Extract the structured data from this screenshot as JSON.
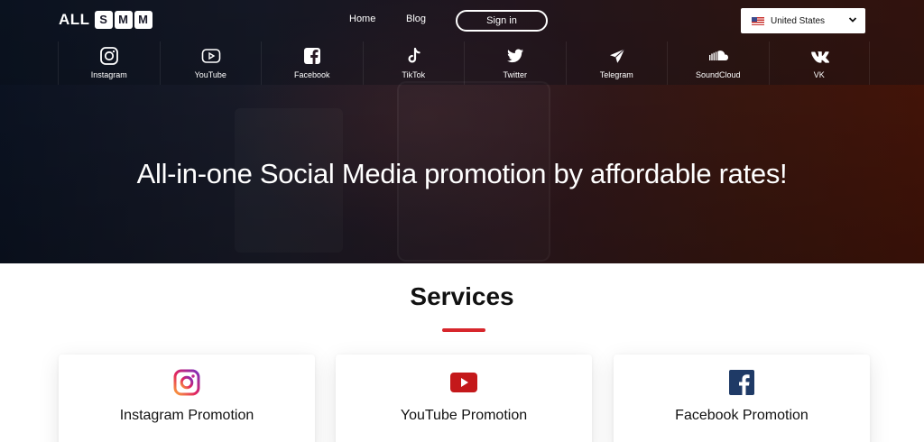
{
  "header": {
    "logo": {
      "prefix": "ALL",
      "letters": [
        "S",
        "M",
        "M"
      ]
    },
    "nav": {
      "home": "Home",
      "blog": "Blog",
      "signin": "Sign in"
    },
    "country": {
      "label": "United States",
      "flag_icon": "us-flag-icon"
    }
  },
  "social_nav": [
    {
      "label": "Instagram",
      "icon": "instagram-icon"
    },
    {
      "label": "YouTube",
      "icon": "youtube-icon"
    },
    {
      "label": "Facebook",
      "icon": "facebook-icon"
    },
    {
      "label": "TikTok",
      "icon": "tiktok-icon"
    },
    {
      "label": "Twitter",
      "icon": "twitter-icon"
    },
    {
      "label": "Telegram",
      "icon": "telegram-icon"
    },
    {
      "label": "SoundCloud",
      "icon": "soundcloud-icon"
    },
    {
      "label": "VK",
      "icon": "vk-icon"
    }
  ],
  "hero": {
    "title": "All-in-one Social Media promotion by affordable rates!"
  },
  "services": {
    "title": "Services",
    "accent_color": "#d7262c",
    "cards": [
      {
        "title": "Instagram Promotion",
        "icon": "instagram-color-icon"
      },
      {
        "title": "YouTube Promotion",
        "icon": "youtube-color-icon"
      },
      {
        "title": "Facebook Promotion",
        "icon": "facebook-color-icon"
      }
    ]
  }
}
